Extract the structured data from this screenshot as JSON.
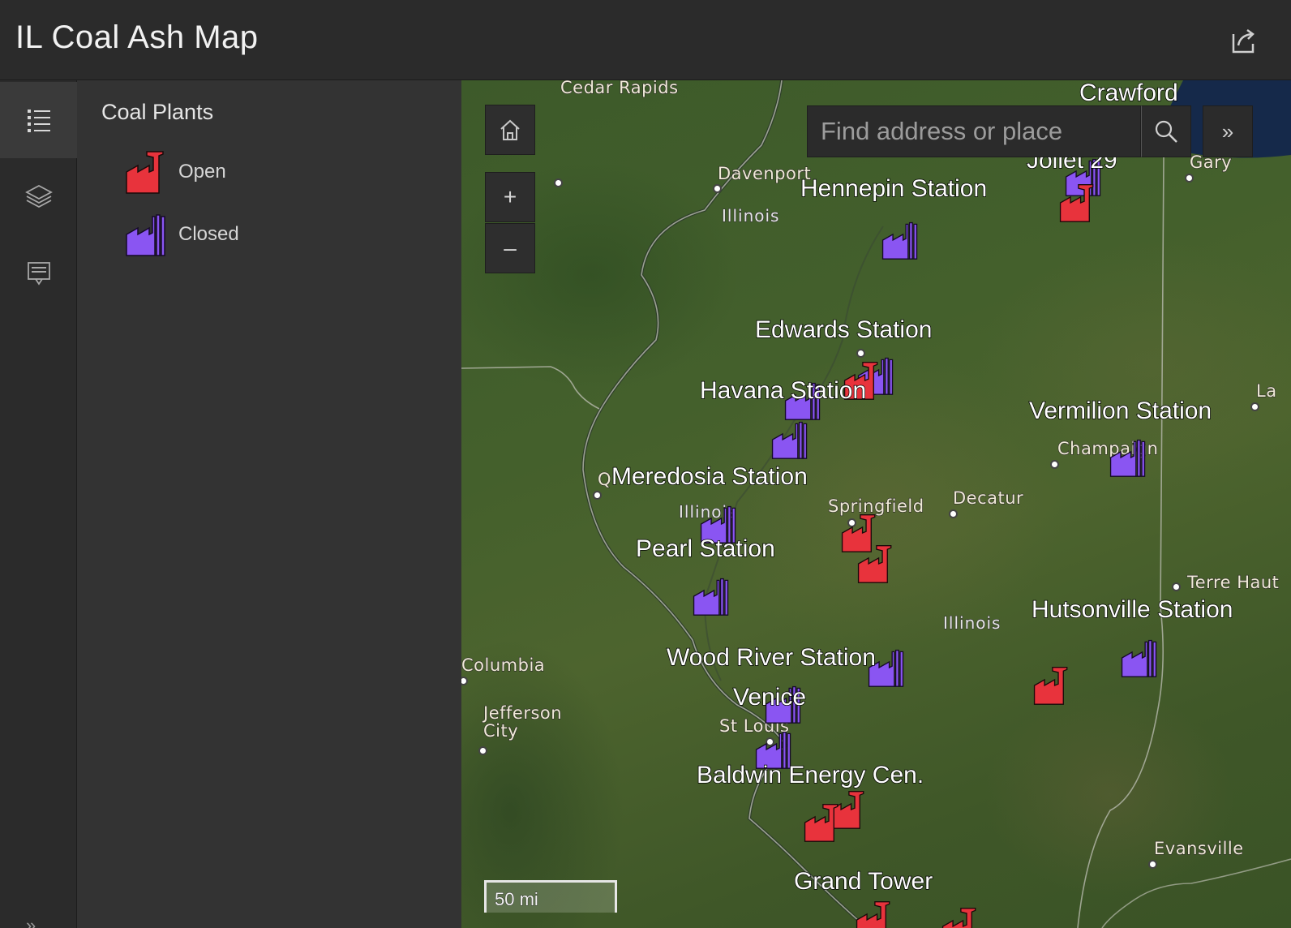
{
  "header": {
    "title": "IL Coal Ash Map",
    "share_icon": "share-icon"
  },
  "rail": {
    "items": [
      {
        "name": "legend",
        "icon": "list-icon",
        "active": true
      },
      {
        "name": "layers",
        "icon": "layers-icon",
        "active": false
      },
      {
        "name": "details",
        "icon": "details-icon",
        "active": false
      }
    ],
    "collapse_glyph": "»"
  },
  "legend": {
    "title": "Coal Plants",
    "items": [
      {
        "label": "Open",
        "color": "#e8333c"
      },
      {
        "label": "Closed",
        "color": "#8a55f2"
      }
    ]
  },
  "map": {
    "search": {
      "placeholder": "Find address or place"
    },
    "expand_glyph": "»",
    "zoom_in": "+",
    "zoom_out": "–",
    "scale_text": "50 mi",
    "plant_labels": [
      "Crawford",
      "Joliet 29",
      "Hennepin Station",
      "Edwards Station",
      "Havana Station",
      "Vermilion Station",
      "Meredosia Station",
      "Pearl Station",
      "Hutsonville Station",
      "Wood River Station",
      "Venice",
      "Baldwin Energy Cen.",
      "Grand Tower"
    ],
    "city_labels": [
      "Cedar Rapids",
      "Davenport",
      "Gary",
      "Champaign",
      "Decatur",
      "Springfield",
      "Q",
      "Terre Haut",
      "Columbia",
      "Jefferson City",
      "St Louis",
      "Evansville",
      "La"
    ],
    "state_labels": [
      "Illinois",
      "Illinois",
      "Illinois"
    ],
    "colors": {
      "open": "#e8333c",
      "closed": "#8a55f2"
    }
  }
}
